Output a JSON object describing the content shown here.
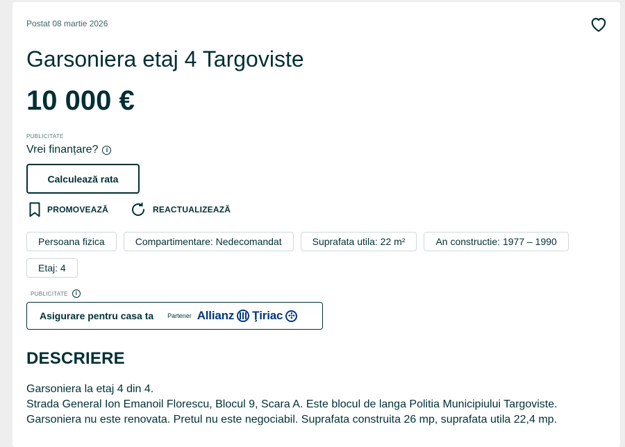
{
  "posted": "Postat 08 martie 2026",
  "title": "Garsoniera etaj 4 Targoviste",
  "price": "10 000 €",
  "ad_label": "PUBLICITATE",
  "financing": {
    "question": "Vrei finanțare?",
    "info_icon": "info-icon",
    "button_label": "Calculează rata"
  },
  "actions": {
    "promote_label": "PROMOVEAZĂ",
    "promote_icon": "bookmark-icon",
    "refresh_label": "REACTUALIZEAZĂ",
    "refresh_icon": "refresh-icon"
  },
  "tags": [
    "Persoana fizica",
    "Compartimentare: Nedecomandat",
    "Suprafata utila: 22 m²",
    "An constructie: 1977 – 1990",
    "Etaj: 4"
  ],
  "insurance": {
    "ad_label": "PUBLICITATE",
    "button_label": "Asigurare pentru casa ta",
    "partner_label": "Partener",
    "brand_part1": "Allianz",
    "brand_part2": "Ţiriac"
  },
  "description": {
    "heading": "DESCRIERE",
    "lines": [
      "Garsoniera la etaj 4 din 4.",
      "Strada General Ion Emanoil Florescu, Blocul 9, Scara A. Este blocul de langa Politia Municipiului Targoviste.",
      "Garsoniera nu este renovata. Pretul nu este negociabil. Suprafata construita 26 mp, suprafata utila 22,4 mp."
    ]
  },
  "colors": {
    "text": "#002f34",
    "muted": "#406367",
    "border": "#cfd8d9",
    "brand": "#003781",
    "background": "#eeeeee"
  }
}
